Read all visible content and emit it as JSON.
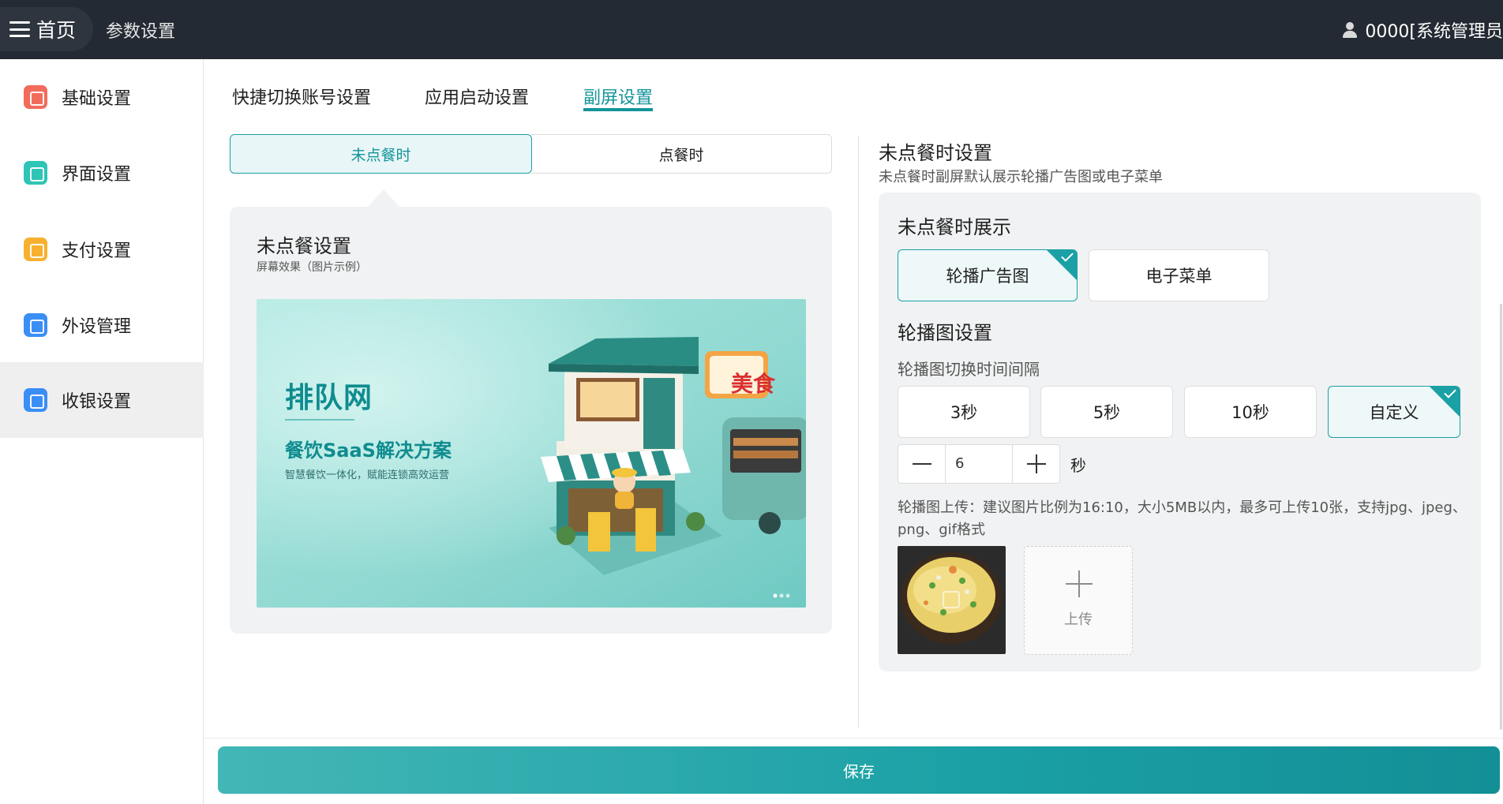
{
  "topbar": {
    "home_label": "首页",
    "breadcrumb": "参数设置",
    "user_label": "0000[系统管理员"
  },
  "sidebar": {
    "items": [
      {
        "label": "基础设置",
        "icon": "list-icon",
        "color": "#f26b5b"
      },
      {
        "label": "界面设置",
        "icon": "display-icon",
        "color": "#2ec4b6"
      },
      {
        "label": "支付设置",
        "icon": "yen-icon",
        "color": "#f7b12f"
      },
      {
        "label": "外设管理",
        "icon": "chart-icon",
        "color": "#3a8ef6"
      },
      {
        "label": "收银设置",
        "icon": "gear-icon",
        "color": "#3a8ef6"
      }
    ],
    "active_index": 4
  },
  "tabs": [
    {
      "label": "快捷切换账号设置"
    },
    {
      "label": "应用启动设置"
    },
    {
      "label": "副屏设置"
    }
  ],
  "segments": [
    "未点餐时",
    "点餐时"
  ],
  "preview": {
    "title": "未点餐设置",
    "subtitle": "屏幕效果（图片示例）",
    "banner": {
      "logo": "排队网",
      "headline": "餐饮SaaS解决方案",
      "tagline": "智慧餐饮一体化，赋能连锁高效运营",
      "sign": "美食"
    }
  },
  "settings": {
    "title": "未点餐时设置",
    "subtitle": "未点餐时副屏默认展示轮播广告图或电子菜单",
    "display_section": {
      "title": "未点餐时展示",
      "options": [
        "轮播广告图",
        "电子菜单"
      ],
      "selected": "轮播广告图"
    },
    "carousel_section": {
      "title": "轮播图设置",
      "interval_label": "轮播图切换时间间隔",
      "interval_options": [
        "3秒",
        "5秒",
        "10秒",
        "自定义"
      ],
      "selected": "自定义",
      "custom_value": "6",
      "unit": "秒",
      "upload_hint": "轮播图上传：建议图片比例为16:10，大小5MB以内，最多可上传10张，支持jpg、jpeg、png、gif格式",
      "upload_label": "上传"
    }
  },
  "save_label": "保存",
  "accent_color": "#1aa0a5"
}
